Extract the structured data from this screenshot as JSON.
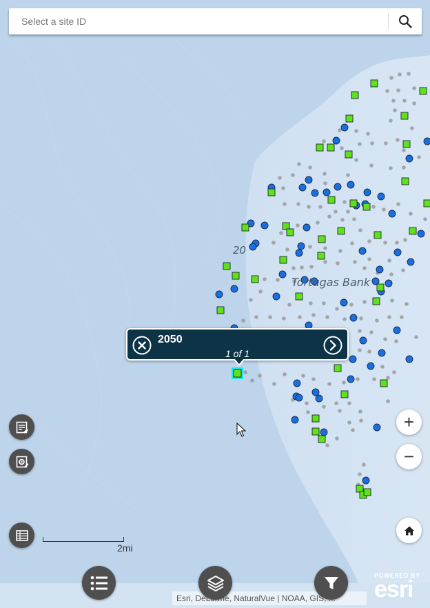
{
  "search": {
    "placeholder": "Select a site ID"
  },
  "popup": {
    "title": "2050",
    "count": "1 of 1"
  },
  "map_labels": {
    "depth": "20",
    "bank": "Tortugas Bank"
  },
  "scale_bar": {
    "label": "2mi"
  },
  "attribution": "Esri, DeLorme, NaturalVue | NOAA, GIS, ...",
  "logo": {
    "powered_by": "POWERED BY",
    "brand": "esri"
  },
  "zoom": {
    "in_label": "+",
    "out_label": "−"
  },
  "colors": {
    "site_circle": "#1a6fe0",
    "site_square": "#5ee21a",
    "small_dot": "#9a9a9a",
    "selected_highlight": "#1ee7f2",
    "popup_bg": "#0d3346",
    "tool_button": "#4f4f4f"
  },
  "icons": {
    "search": "magnifier-icon",
    "popup_close": "close-circle-icon",
    "popup_next": "chevron-right-circle-icon",
    "legend": "legend-doc-icon",
    "settings": "settings-doc-icon",
    "table": "table-icon",
    "home": "home-icon",
    "list": "list-icon",
    "layers": "layers-icon",
    "filter": "filter-icon"
  }
}
